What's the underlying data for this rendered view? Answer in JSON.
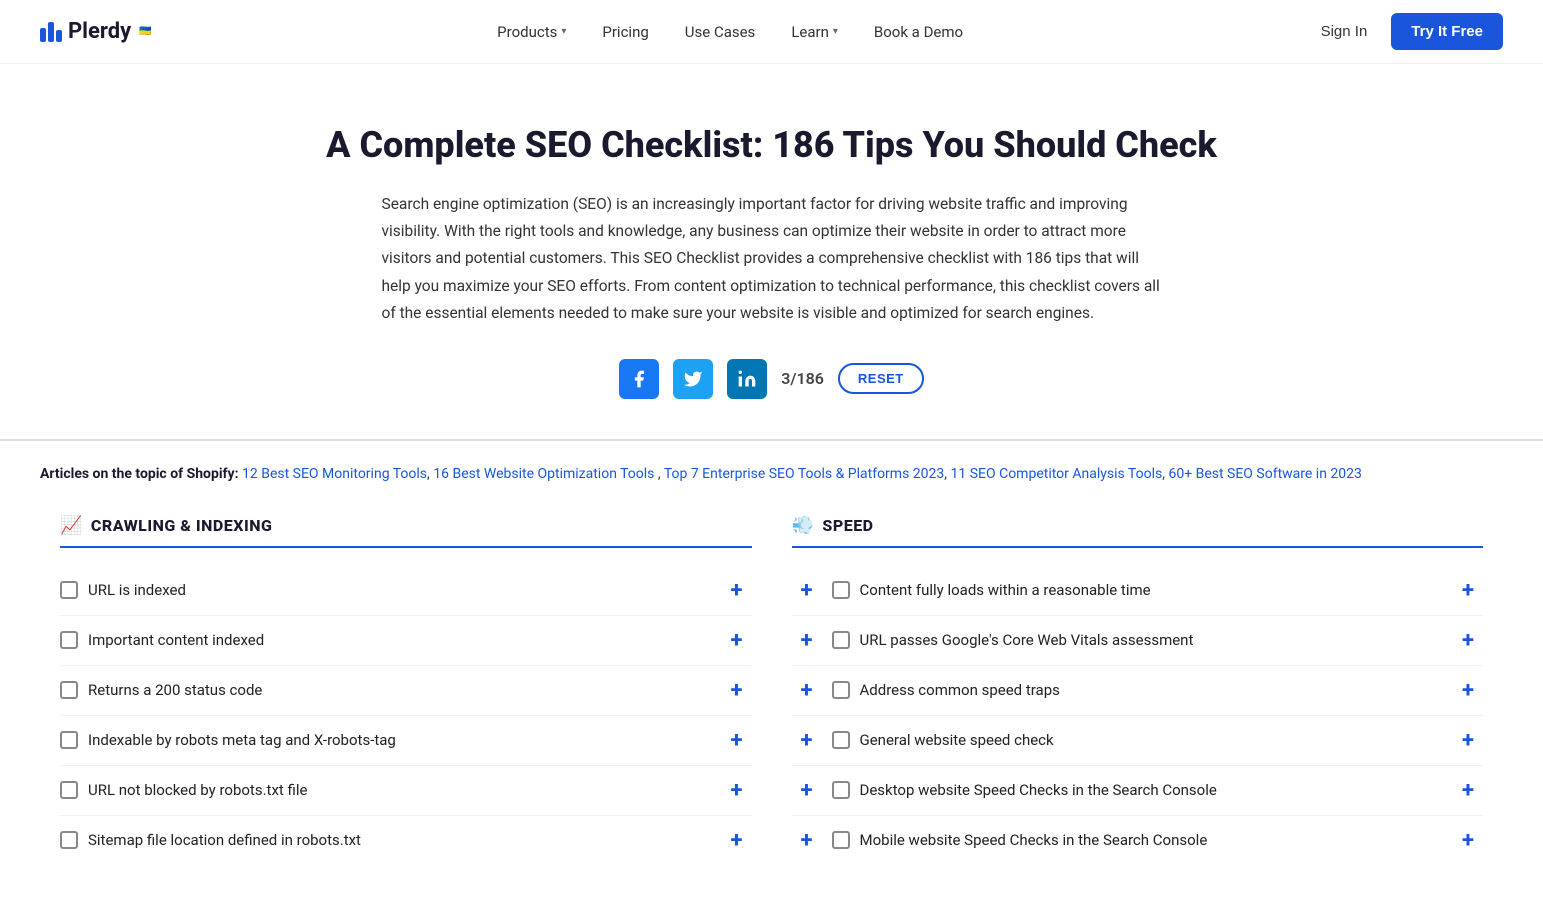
{
  "header": {
    "logo_text": "Plerdy",
    "nav_items": [
      {
        "label": "Products",
        "has_dropdown": true
      },
      {
        "label": "Pricing",
        "has_dropdown": false
      },
      {
        "label": "Use Cases",
        "has_dropdown": false
      },
      {
        "label": "Learn",
        "has_dropdown": true
      },
      {
        "label": "Book a Demo",
        "has_dropdown": false
      }
    ],
    "sign_in": "Sign In",
    "try_free": "Try It Free"
  },
  "hero": {
    "title": "A Complete SEO Checklist: 186 Tips You Should Check",
    "description": "Search engine optimization (SEO) is an increasingly important factor for driving website traffic and improving visibility. With the right tools and knowledge, any business can optimize their website in order to attract more visitors and potential customers. This SEO Checklist provides a comprehensive checklist with 186 tips that will help you maximize your SEO efforts. From content optimization to technical performance, this checklist covers all of the essential elements needed to make sure your website is visible and optimized for search engines.",
    "counter": "3/186",
    "reset_label": "RESET"
  },
  "articles": {
    "prefix": "Articles on the topic of Shopify:",
    "links": [
      "12 Best SEO Monitoring Tools",
      "16 Best Website Optimization Tools",
      "Top 7 Enterprise SEO Tools & Platforms 2023",
      "11 SEO Competitor Analysis Tools",
      "60+ Best SEO Software in 2023"
    ]
  },
  "crawling_section": {
    "title": "CRAWLING & INDEXING",
    "icon": "📈",
    "items": [
      "URL is indexed",
      "Important content indexed",
      "Returns a 200 status code",
      "Indexable by robots meta tag and X-robots-tag",
      "URL not blocked by robots.txt file",
      "Sitemap file location defined in robots.txt"
    ]
  },
  "speed_section": {
    "title": "SPEED",
    "icon": "💨",
    "items": [
      "Content fully loads within a reasonable time",
      "URL passes Google's Core Web Vitals assessment",
      "Address common speed traps",
      "General website speed check",
      "Desktop website Speed Checks in the Search Console",
      "Mobile website Speed Checks in the Search Console"
    ]
  }
}
